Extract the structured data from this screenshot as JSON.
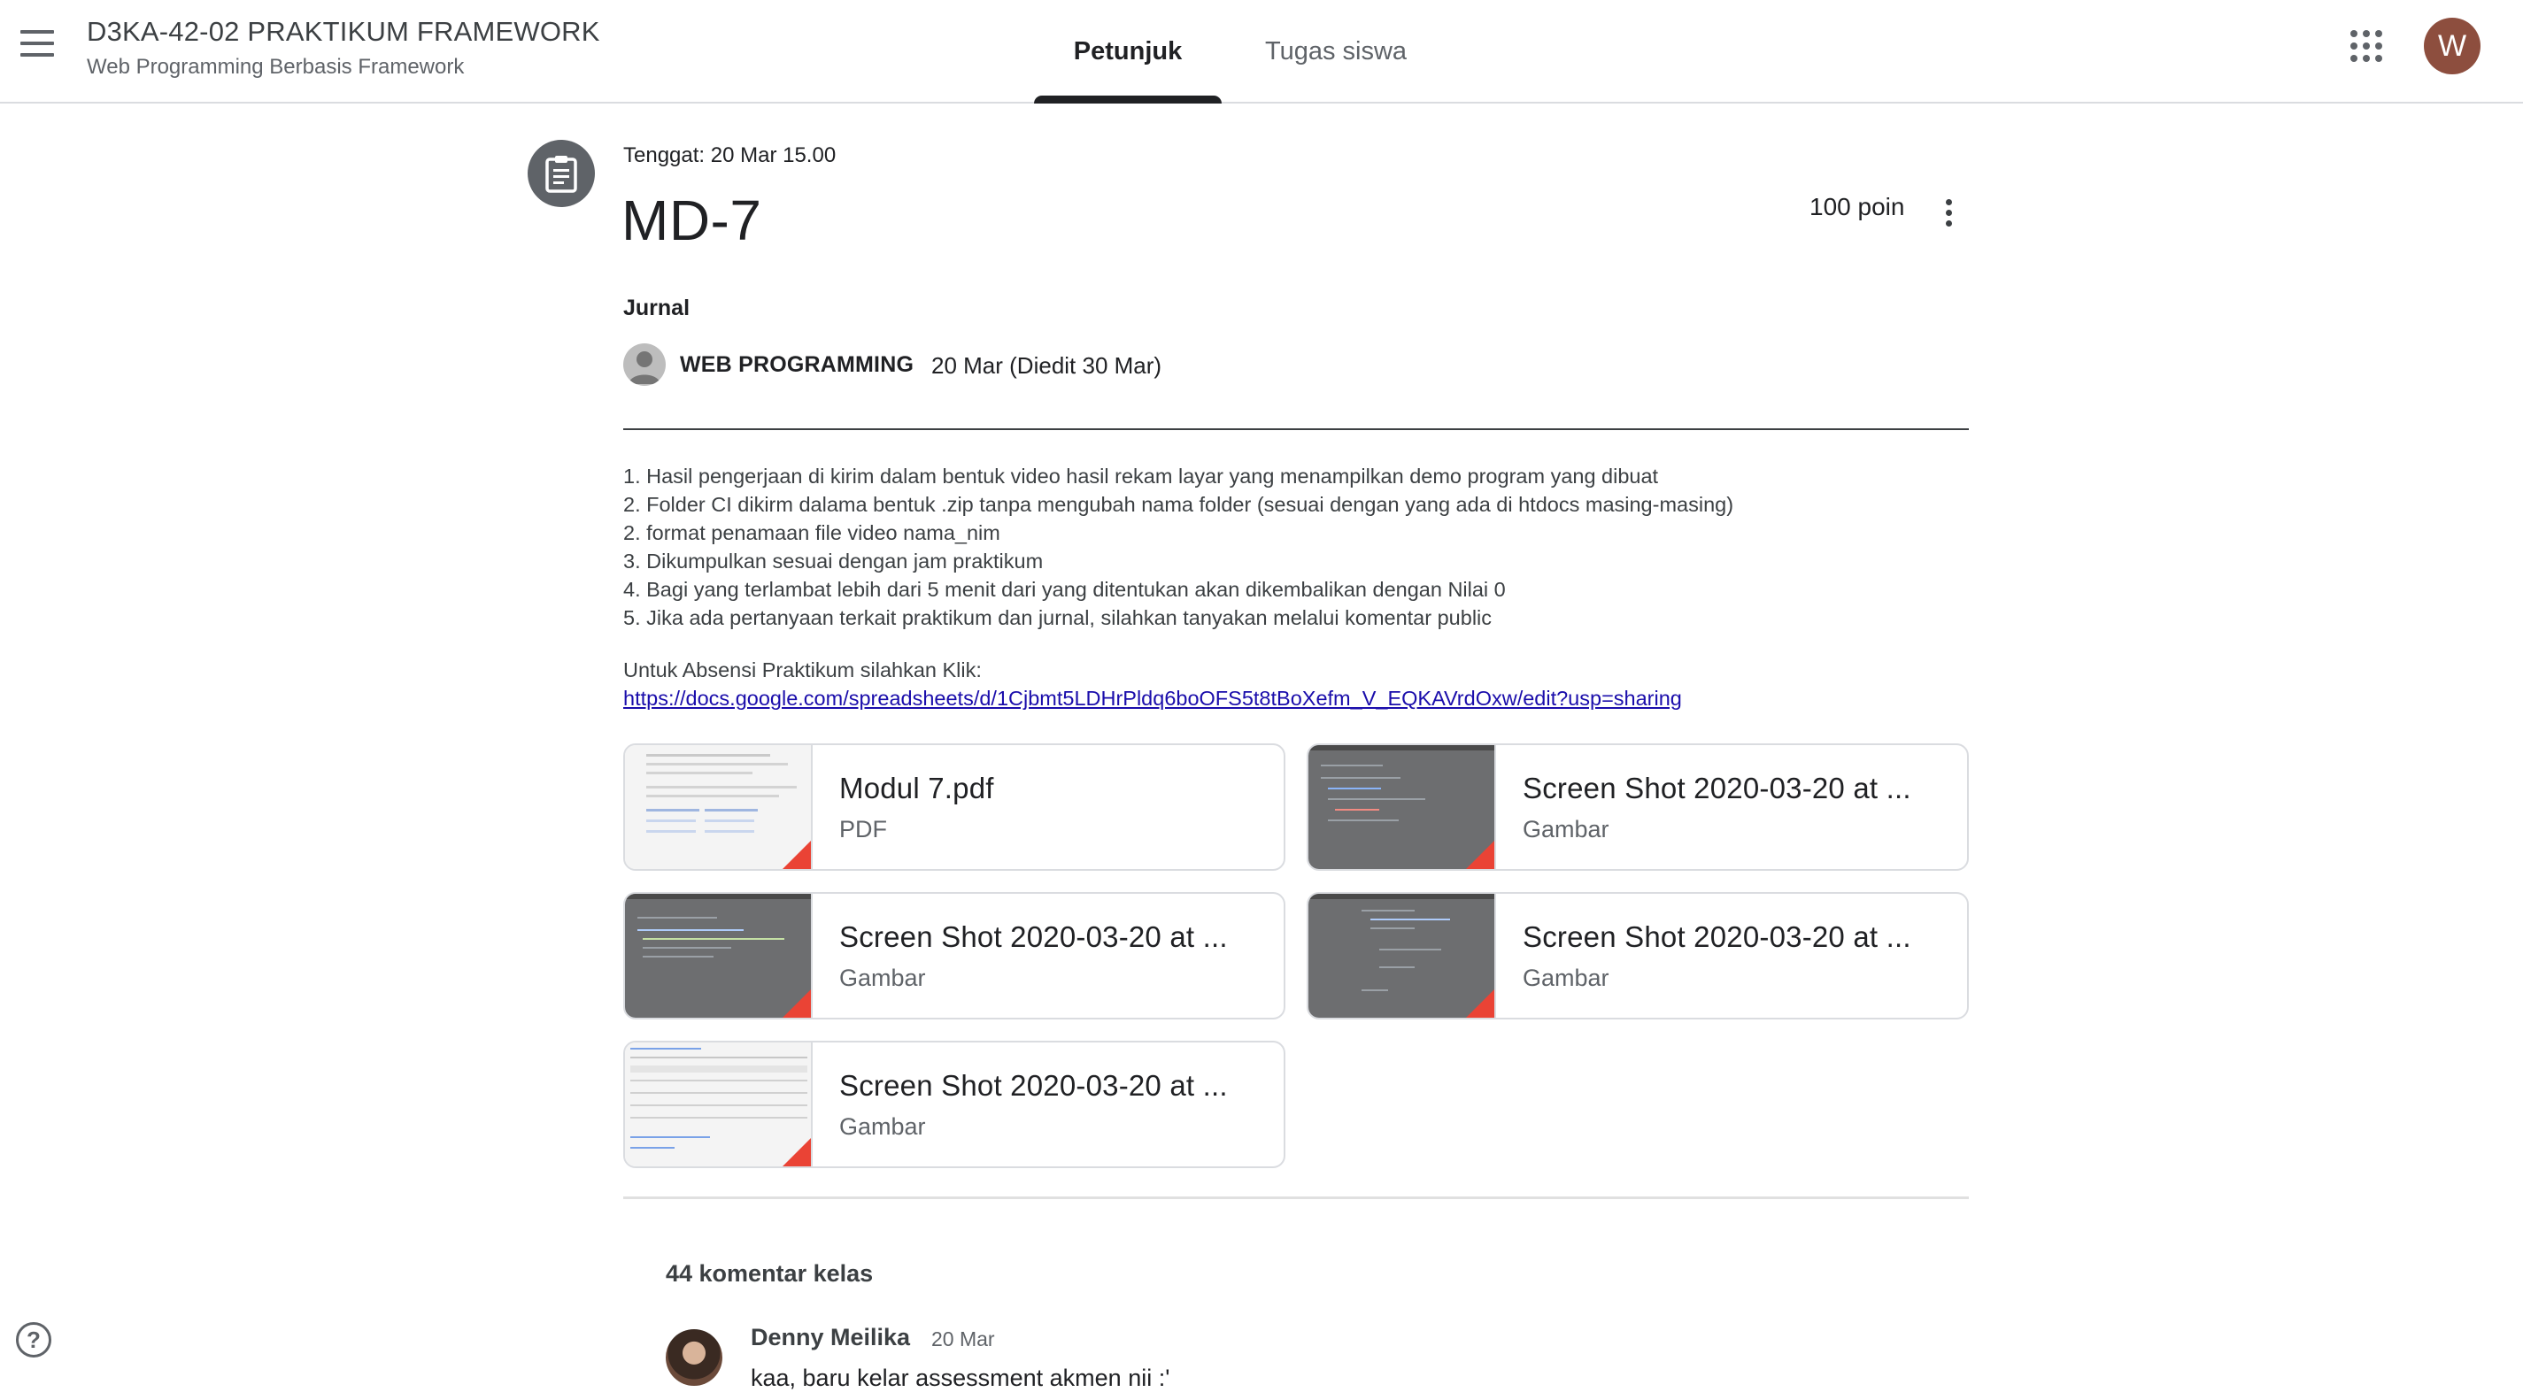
{
  "header": {
    "course_title": "D3KA-42-02 PRAKTIKUM FRAMEWORK",
    "course_subtitle": "Web Programming Berbasis Framework",
    "tabs": [
      {
        "label": "Petunjuk",
        "active": true
      },
      {
        "label": "Tugas siswa",
        "active": false
      }
    ],
    "avatar_initial": "W",
    "menu_icon": "hamburger-menu-icon",
    "apps_icon": "apps-grid-icon"
  },
  "assignment": {
    "icon": "assignment-clipboard-icon",
    "due": "Tenggat: 20 Mar 15.00",
    "title": "MD-7",
    "points": "100 poin",
    "topic": "Jurnal",
    "author": "WEB PROGRAMMING",
    "date": "20 Mar (Diedit 30 Mar)",
    "instructions": [
      "1. Hasil pengerjaan di kirim dalam bentuk video hasil rekam layar yang menampilkan demo program yang dibuat",
      "2. Folder CI dikirm dalama bentuk .zip tanpa mengubah nama folder (sesuai dengan yang ada di htdocs masing-masing)",
      "2. format penamaan file video nama_nim",
      "3. Dikumpulkan sesuai dengan jam praktikum",
      "4. Bagi yang terlambat lebih dari 5 menit dari yang ditentukan akan dikembalikan dengan Nilai 0",
      "5. Jika ada pertanyaan terkait praktikum dan jurnal, silahkan tanyakan melalui komentar public"
    ],
    "attendance_label": "Untuk Absensi Praktikum silahkan Klik:",
    "attendance_link": "https://docs.google.com/spreadsheets/d/1Cjbmt5LDHrPldq6boOFS5t8tBoXefm_V_EQKAVrdOxw/edit?usp=sharing"
  },
  "attachments": [
    {
      "name": "Modul 7.pdf",
      "type": "PDF"
    },
    {
      "name": "Screen Shot 2020-03-20 at ...",
      "type": "Gambar"
    },
    {
      "name": "Screen Shot 2020-03-20 at ...",
      "type": "Gambar"
    },
    {
      "name": "Screen Shot 2020-03-20 at ...",
      "type": "Gambar"
    },
    {
      "name": "Screen Shot 2020-03-20 at ...",
      "type": "Gambar"
    }
  ],
  "comments": {
    "count_label": "44 komentar kelas",
    "items": [
      {
        "author": "Denny Meilika",
        "date": "20 Mar",
        "text": "kaa, baru kelar assessment akmen nii :'"
      }
    ]
  },
  "colors": {
    "tab_indicator": "#202124",
    "avatar_bg": "#8d4e3e",
    "link": "#1a0dab",
    "pdf_corner": "#ea4335"
  }
}
